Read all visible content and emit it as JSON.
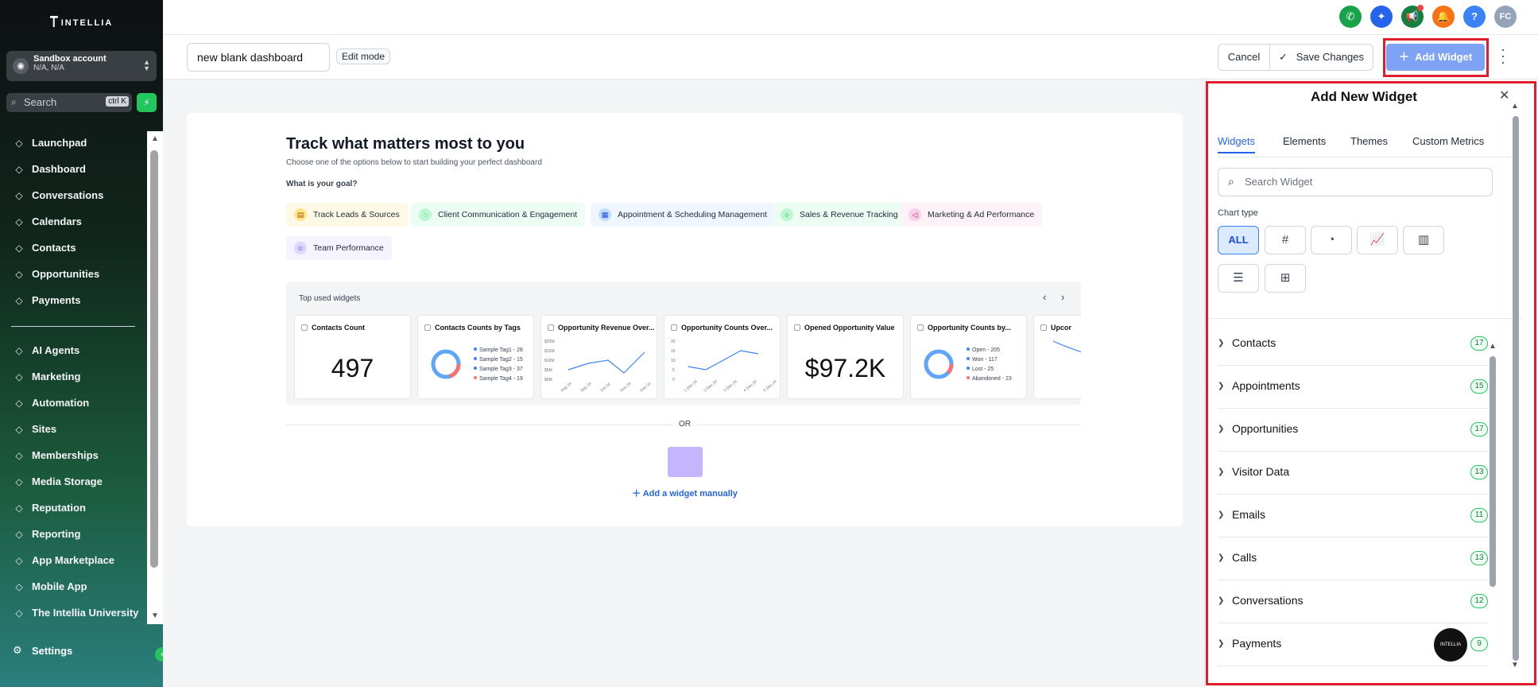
{
  "brand": "INTELLIA",
  "account": {
    "name": "Sandbox account",
    "location": "N/A, N/A"
  },
  "sidebar_search": {
    "placeholder": "Search",
    "shortcut": "ctrl K"
  },
  "nav_top": [
    {
      "label": "Launchpad",
      "icon": "rocket-icon"
    },
    {
      "label": "Dashboard",
      "icon": "grid-icon"
    },
    {
      "label": "Conversations",
      "icon": "chat-icon"
    },
    {
      "label": "Calendars",
      "icon": "calendar-icon"
    },
    {
      "label": "Contacts",
      "icon": "contacts-icon"
    },
    {
      "label": "Opportunities",
      "icon": "network-icon"
    },
    {
      "label": "Payments",
      "icon": "receipt-icon"
    }
  ],
  "nav_bottom": [
    {
      "label": "AI Agents",
      "icon": "sparkle-icon"
    },
    {
      "label": "Marketing",
      "icon": "send-icon"
    },
    {
      "label": "Automation",
      "icon": "automation-icon"
    },
    {
      "label": "Sites",
      "icon": "sites-icon"
    },
    {
      "label": "Memberships",
      "icon": "membership-icon"
    },
    {
      "label": "Media Storage",
      "icon": "image-icon"
    },
    {
      "label": "Reputation",
      "icon": "star-icon"
    },
    {
      "label": "Reporting",
      "icon": "trend-icon"
    },
    {
      "label": "App Marketplace",
      "icon": "apps-icon"
    },
    {
      "label": "Mobile App",
      "icon": "mobile-icon"
    },
    {
      "label": "The Intellia University",
      "icon": "graduation-icon"
    }
  ],
  "settings_label": "Settings",
  "topbar": {
    "avatar_initials": "FC",
    "help_label": "?"
  },
  "toolbar": {
    "dashboard_name": "new blank dashboard",
    "edit_mode": "Edit mode",
    "cancel": "Cancel",
    "save": "Save Changes",
    "add_widget": "Add Widget"
  },
  "main": {
    "title": "Track what matters most to you",
    "subtitle": "Choose one of the options below to start building your perfect dashboard",
    "goal_label": "What is your goal?",
    "goals": [
      "Track Leads & Sources",
      "Client Communication & Engagement",
      "Appointment & Scheduling Management",
      "Sales & Revenue Tracking",
      "Marketing & Ad Performance",
      "Team Performance"
    ],
    "top_used_title": "Top used widgets",
    "widgets": [
      {
        "title": "Contacts Count",
        "value": "497"
      },
      {
        "title": "Contacts Counts by Tags",
        "legend": [
          "Sample Tag1 - 28",
          "Sample Tag2 - 15",
          "Sample Tag3 - 37",
          "Sample Tag4 - 19"
        ]
      },
      {
        "title": "Opportunity Revenue Over...",
        "yticks": [
          "$20M",
          "$15M",
          "$10M",
          "$5M",
          "$0M"
        ],
        "xticks": [
          "Aug 24",
          "Sep 24",
          "Oct 24",
          "Nov 24",
          "Dec 24"
        ]
      },
      {
        "title": "Opportunity Counts Over...",
        "yticks": [
          "20",
          "15",
          "10",
          "5",
          "0"
        ],
        "xticks": [
          "1 Dec 24",
          "2 Dec 24",
          "3 Dec 24",
          "4 Dec 24",
          "5 Dec 24"
        ]
      },
      {
        "title": "Opened Opportunity Value",
        "value": "$97.2K"
      },
      {
        "title": "Opportunity Counts by...",
        "legend": [
          "Open - 205",
          "Won - 117",
          "Lost - 25",
          "Abandoned - 23"
        ]
      },
      {
        "title": "Upcor"
      }
    ],
    "or_label": "OR",
    "add_manual": "Add a widget manually"
  },
  "panel": {
    "title": "Add New Widget",
    "tabs": [
      "Widgets",
      "Elements",
      "Themes",
      "Custom Metrics"
    ],
    "search_placeholder": "Search Widget",
    "chart_type_label": "Chart type",
    "chart_all": "ALL",
    "categories": [
      {
        "name": "Contacts",
        "count": "17"
      },
      {
        "name": "Appointments",
        "count": "15"
      },
      {
        "name": "Opportunities",
        "count": "17"
      },
      {
        "name": "Visitor Data",
        "count": "13"
      },
      {
        "name": "Emails",
        "count": "11"
      },
      {
        "name": "Calls",
        "count": "13"
      },
      {
        "name": "Conversations",
        "count": "12"
      },
      {
        "name": "Payments",
        "count": "9"
      }
    ]
  },
  "colors": {
    "accent": "#2563eb",
    "highlight": "#e11d2b",
    "success": "#22c55e"
  }
}
